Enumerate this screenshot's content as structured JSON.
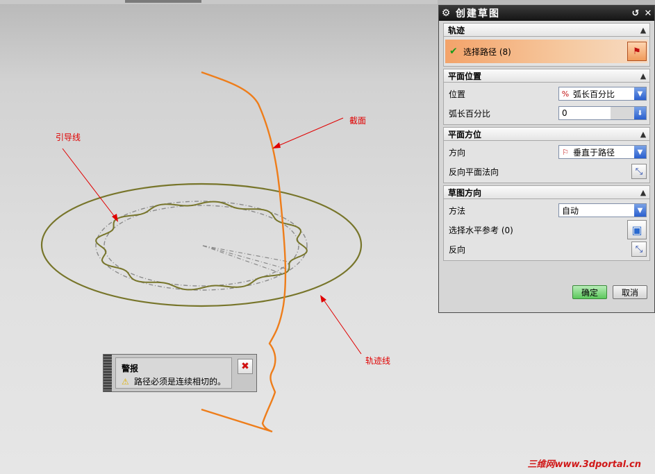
{
  "annotations": {
    "section_label": "截面",
    "guide_label": "引导线",
    "trajectory_label": "轨迹线"
  },
  "dialog": {
    "title": "创建草图",
    "trajectory": {
      "header": "轨迹",
      "select_path_label": "选择路径 (8)"
    },
    "plane_position": {
      "header": "平面位置",
      "position_label": "位置",
      "position_value": "弧长百分比",
      "arc_percent_label": "弧长百分比",
      "arc_percent_value": "0"
    },
    "plane_orientation": {
      "header": "平面方位",
      "direction_label": "方向",
      "direction_value": "垂直于路径",
      "reverse_normal_label": "反向平面法向"
    },
    "sketch_orientation": {
      "header": "草图方向",
      "method_label": "方法",
      "method_value": "自动",
      "select_horizontal_ref_label": "选择水平参考 (0)",
      "reverse_label": "反向"
    },
    "ok_label": "确定",
    "cancel_label": "取消"
  },
  "alert": {
    "title": "警报",
    "message": "路径必须是连续相切的。"
  },
  "watermark": "三维网www.3dportal.cn",
  "colors": {
    "curve_orange": "#ee7d1a",
    "ellipse_olive": "#77752a",
    "annotation_red": "#e00000",
    "highlight_orange": "#f3a36a"
  }
}
